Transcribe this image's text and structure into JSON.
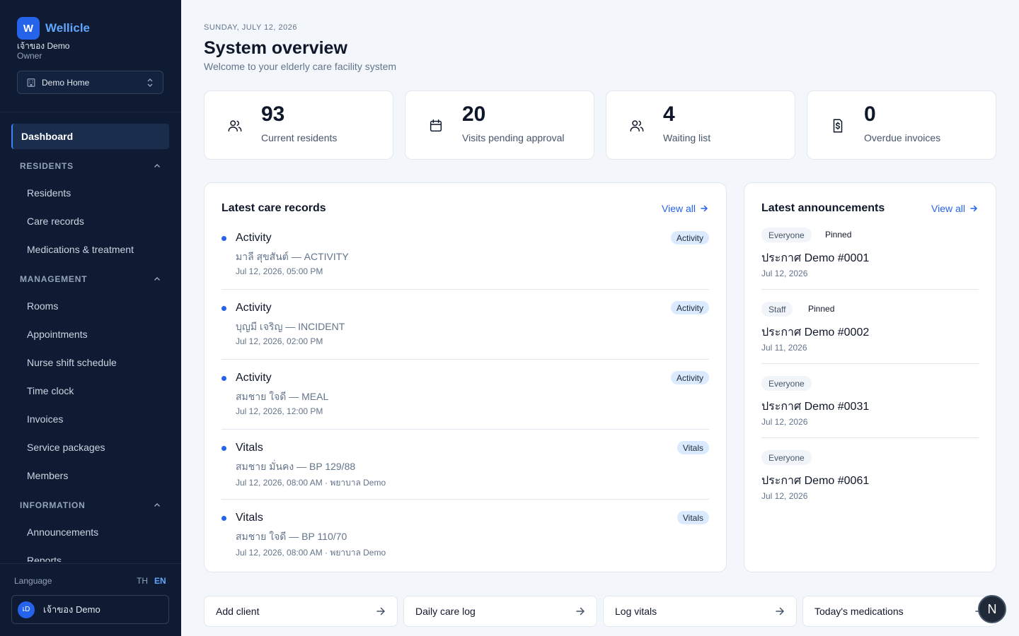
{
  "sidebar": {
    "brand_letter": "W",
    "brand_name": "Wellicle",
    "user_name": "เจ้าของ Demo",
    "user_role": "Owner",
    "home_select": "Demo Home",
    "active_item": "Dashboard",
    "sections": {
      "residents": {
        "label": "RESIDENTS",
        "items": [
          "Residents",
          "Care records",
          "Medications & treatment"
        ]
      },
      "management": {
        "label": "MANAGEMENT",
        "items": [
          "Rooms",
          "Appointments",
          "Nurse shift schedule",
          "Time clock",
          "Invoices",
          "Service packages",
          "Members"
        ]
      },
      "information": {
        "label": "INFORMATION",
        "items": [
          "Announcements",
          "Reports"
        ]
      }
    },
    "language_label": "Language",
    "lang_th": "TH",
    "lang_en": "EN",
    "avatar_initials": "เD",
    "user_card_name": "เจ้าของ Demo"
  },
  "header": {
    "date": "SUNDAY, JULY 12, 2026",
    "title": "System overview",
    "subtitle": "Welcome to your elderly care facility system"
  },
  "stats": [
    {
      "value": "93",
      "label": "Current residents",
      "icon": "users-icon"
    },
    {
      "value": "20",
      "label": "Visits pending approval",
      "icon": "calendar-icon"
    },
    {
      "value": "4",
      "label": "Waiting list",
      "icon": "users-icon"
    },
    {
      "value": "0",
      "label": "Overdue invoices",
      "icon": "invoice-icon"
    }
  ],
  "care_records": {
    "title": "Latest care records",
    "view_all": "View all",
    "items": [
      {
        "title": "Activity",
        "subtitle": "มาลี สุขสันต์ — ACTIVITY",
        "time": "Jul 12, 2026, 05:00 PM",
        "badge": "Activity"
      },
      {
        "title": "Activity",
        "subtitle": "บุญมี เจริญ — INCIDENT",
        "time": "Jul 12, 2026, 02:00 PM",
        "badge": "Activity"
      },
      {
        "title": "Activity",
        "subtitle": "สมชาย ใจดี — MEAL",
        "time": "Jul 12, 2026, 12:00 PM",
        "badge": "Activity"
      },
      {
        "title": "Vitals",
        "subtitle": "สมชาย มั่นคง — BP 129/88",
        "time": "Jul 12, 2026, 08:00 AM · พยาบาล Demo",
        "badge": "Vitals"
      },
      {
        "title": "Vitals",
        "subtitle": "สมชาย ใจดี — BP 110/70",
        "time": "Jul 12, 2026, 08:00 AM · พยาบาล Demo",
        "badge": "Vitals"
      }
    ]
  },
  "announcements": {
    "title": "Latest announcements",
    "view_all": "View all",
    "items": [
      {
        "audience": "Everyone",
        "pinned": "Pinned",
        "title": "ประกาศ Demo #0001",
        "date": "Jul 12, 2026"
      },
      {
        "audience": "Staff",
        "pinned": "Pinned",
        "title": "ประกาศ Demo #0002",
        "date": "Jul 11, 2026"
      },
      {
        "audience": "Everyone",
        "pinned": "",
        "title": "ประกาศ Demo #0031",
        "date": "Jul 12, 2026"
      },
      {
        "audience": "Everyone",
        "pinned": "",
        "title": "ประกาศ Demo #0061",
        "date": "Jul 12, 2026"
      }
    ]
  },
  "quick_actions": [
    "Add client",
    "Daily care log",
    "Log vitals",
    "Today's medications"
  ],
  "fab_letter": "N",
  "colors": {
    "accent": "#2563eb",
    "sidebar_bg": "#0f1b33",
    "page_bg": "#f3f6fa"
  }
}
